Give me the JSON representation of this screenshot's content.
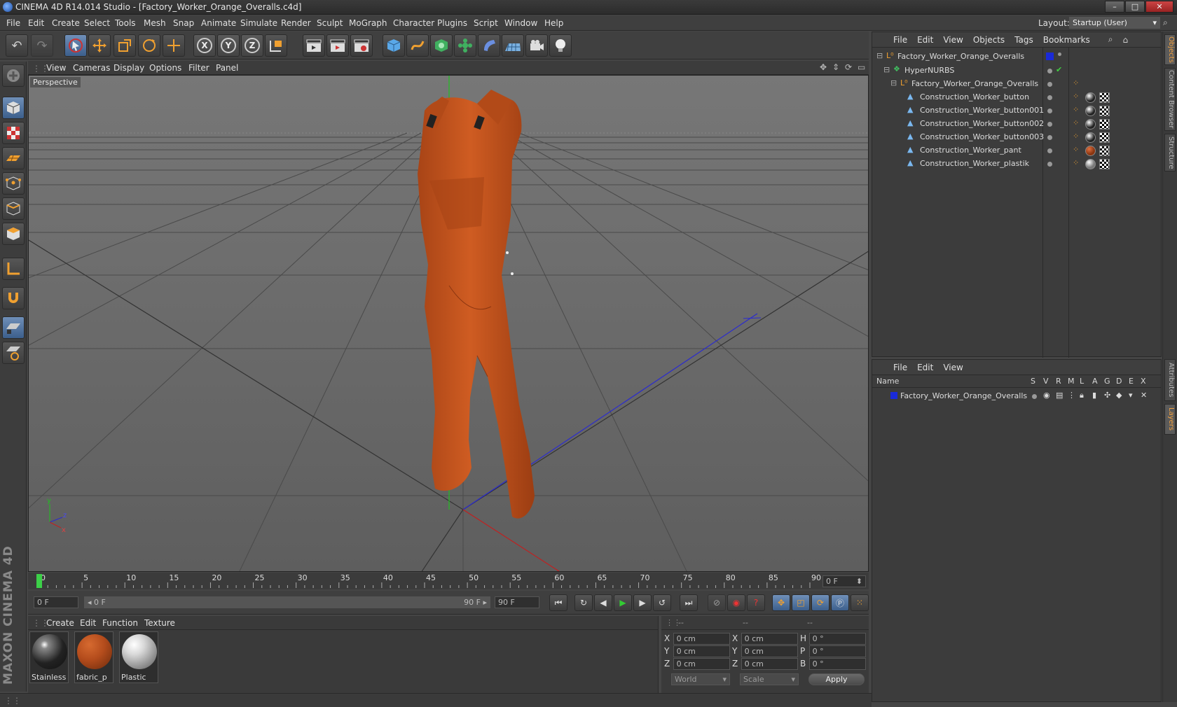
{
  "app": {
    "title": "CINEMA 4D R14.014 Studio - [Factory_Worker_Orange_Overalls.c4d]",
    "window_buttons": [
      "–",
      "□",
      "✕"
    ]
  },
  "menubar": [
    "File",
    "Edit",
    "Create",
    "Select",
    "Tools",
    "Mesh",
    "Snap",
    "Animate",
    "Simulate",
    "Render",
    "Sculpt",
    "MoGraph",
    "Character",
    "Plugins",
    "Script",
    "Window",
    "Help"
  ],
  "layout": {
    "label": "Layout:",
    "value": "Startup (User)"
  },
  "toolbar": {
    "axis_x": "X",
    "axis_y": "Y",
    "axis_z": "Z"
  },
  "viewport": {
    "menu": [
      "View",
      "Cameras",
      "Display",
      "Options",
      "Filter",
      "Panel"
    ],
    "label": "Perspective",
    "axis_labels": {
      "y": "y",
      "z": "z",
      "x": "x"
    },
    "colors": {
      "garment": "#c0521c",
      "bg": "#6a6a6a"
    }
  },
  "timeline": {
    "ticks": [
      "0",
      "5",
      "10",
      "15",
      "20",
      "25",
      "30",
      "35",
      "40",
      "45",
      "50",
      "55",
      "60",
      "65",
      "70",
      "75",
      "80",
      "85",
      "90"
    ],
    "current_frame": "0 F"
  },
  "transport": {
    "start_field": "0 F",
    "range_left": "◂ 0 F",
    "range_right": "90 F ▸",
    "end_field": "90 F"
  },
  "materials": {
    "menu": [
      "Create",
      "Edit",
      "Function",
      "Texture"
    ],
    "items": [
      {
        "name": "Stainless",
        "color": "#1a1a1a"
      },
      {
        "name": "fabric_p",
        "color": "#b44c1c"
      },
      {
        "name": "Plastic",
        "color": "#d8d8d8"
      }
    ]
  },
  "coords": {
    "header": [
      "--",
      "--",
      "--"
    ],
    "rows": [
      {
        "a": "X",
        "av": "0 cm",
        "b": "X",
        "bv": "0 cm",
        "c": "H",
        "cv": "0 °"
      },
      {
        "a": "Y",
        "av": "0 cm",
        "b": "Y",
        "bv": "0 cm",
        "c": "P",
        "cv": "0 °"
      },
      {
        "a": "Z",
        "av": "0 cm",
        "b": "Z",
        "bv": "0 cm",
        "c": "B",
        "cv": "0 °"
      }
    ],
    "world": "World",
    "scale": "Scale",
    "apply": "Apply"
  },
  "objects_panel": {
    "menu": [
      "File",
      "Edit",
      "View",
      "Objects",
      "Tags",
      "Bookmarks"
    ],
    "rows": [
      "Factory_Worker_Orange_Overalls",
      "HyperNURBS",
      "Factory_Worker_Orange_Overalls",
      "Construction_Worker_button",
      "Construction_Worker_button001",
      "Construction_Worker_button002",
      "Construction_Worker_button003",
      "Construction_Worker_pant",
      "Construction_Worker_plastik"
    ]
  },
  "layers_panel": {
    "menu": [
      "File",
      "Edit",
      "View"
    ],
    "columns": [
      "Name",
      "S",
      "V",
      "R",
      "M",
      "L",
      "A",
      "G",
      "D",
      "E",
      "X"
    ],
    "row": "Factory_Worker_Orange_Overalls"
  },
  "right_tabs": [
    "Objects",
    "Content Browser",
    "Structure",
    "Attributes",
    "Layers"
  ],
  "brand": "MAXON CINEMA 4D"
}
